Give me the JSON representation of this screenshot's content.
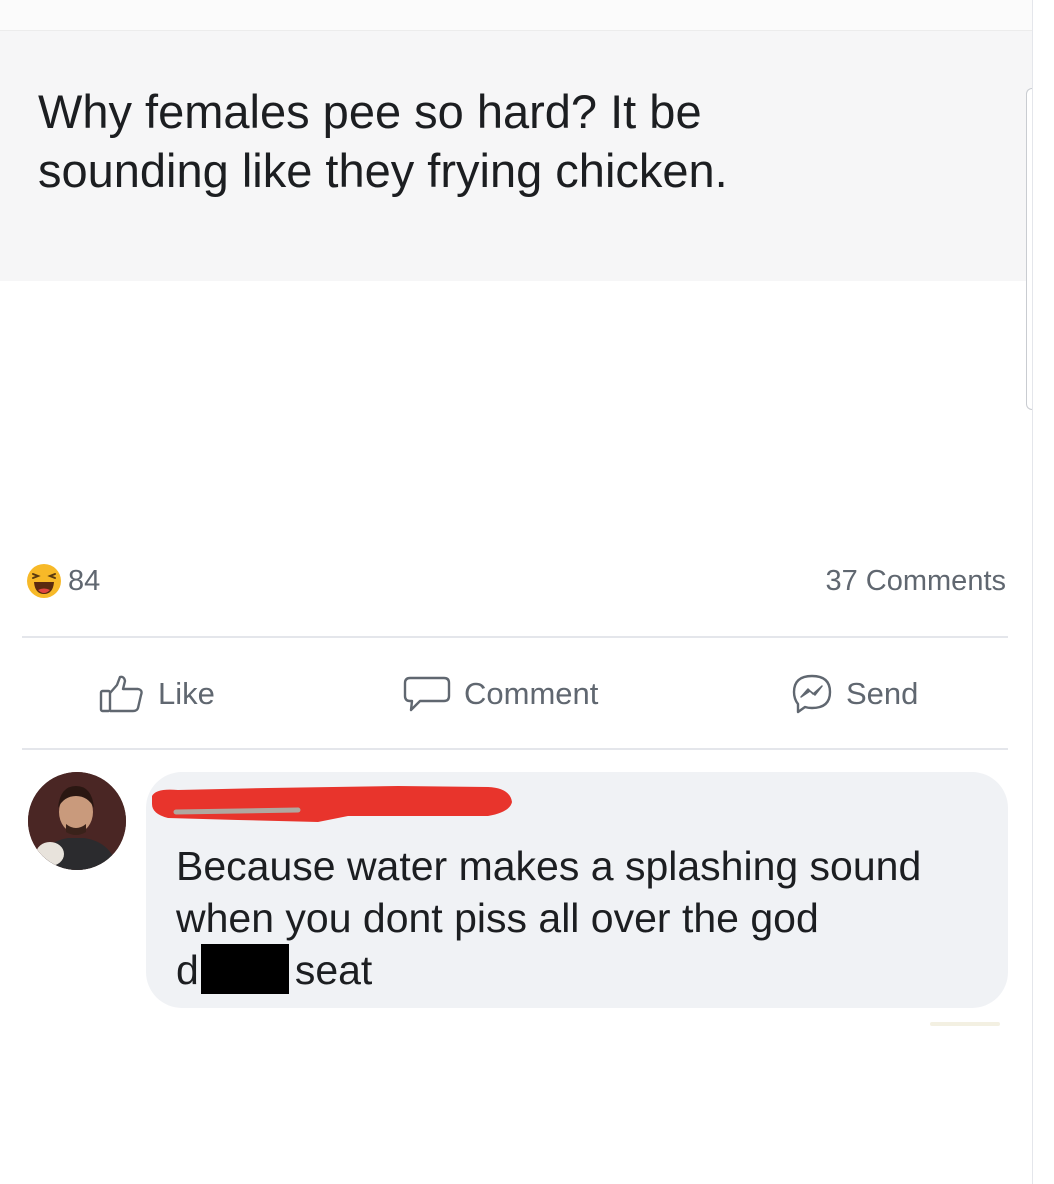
{
  "post": {
    "text_line1": "Why females pee so hard? It be",
    "text_line2": "sounding like they frying chicken."
  },
  "reactions": {
    "icon": "haha-emoji-icon",
    "count": "84"
  },
  "comments_count": "37 Comments",
  "actions": {
    "like_label": "Like",
    "comment_label": "Comment",
    "send_label": "Send"
  },
  "comment": {
    "author_redacted": true,
    "line1": "Because water makes a splashing sound",
    "line2": "when you dont piss all over the god",
    "line3_prefix": "d",
    "line3_suffix": "seat"
  },
  "colors": {
    "text": "#1c1e21",
    "secondary_text": "#606770",
    "bubble": "#f0f2f5",
    "redaction_red": "#e8342c",
    "redaction_black": "#000000"
  }
}
